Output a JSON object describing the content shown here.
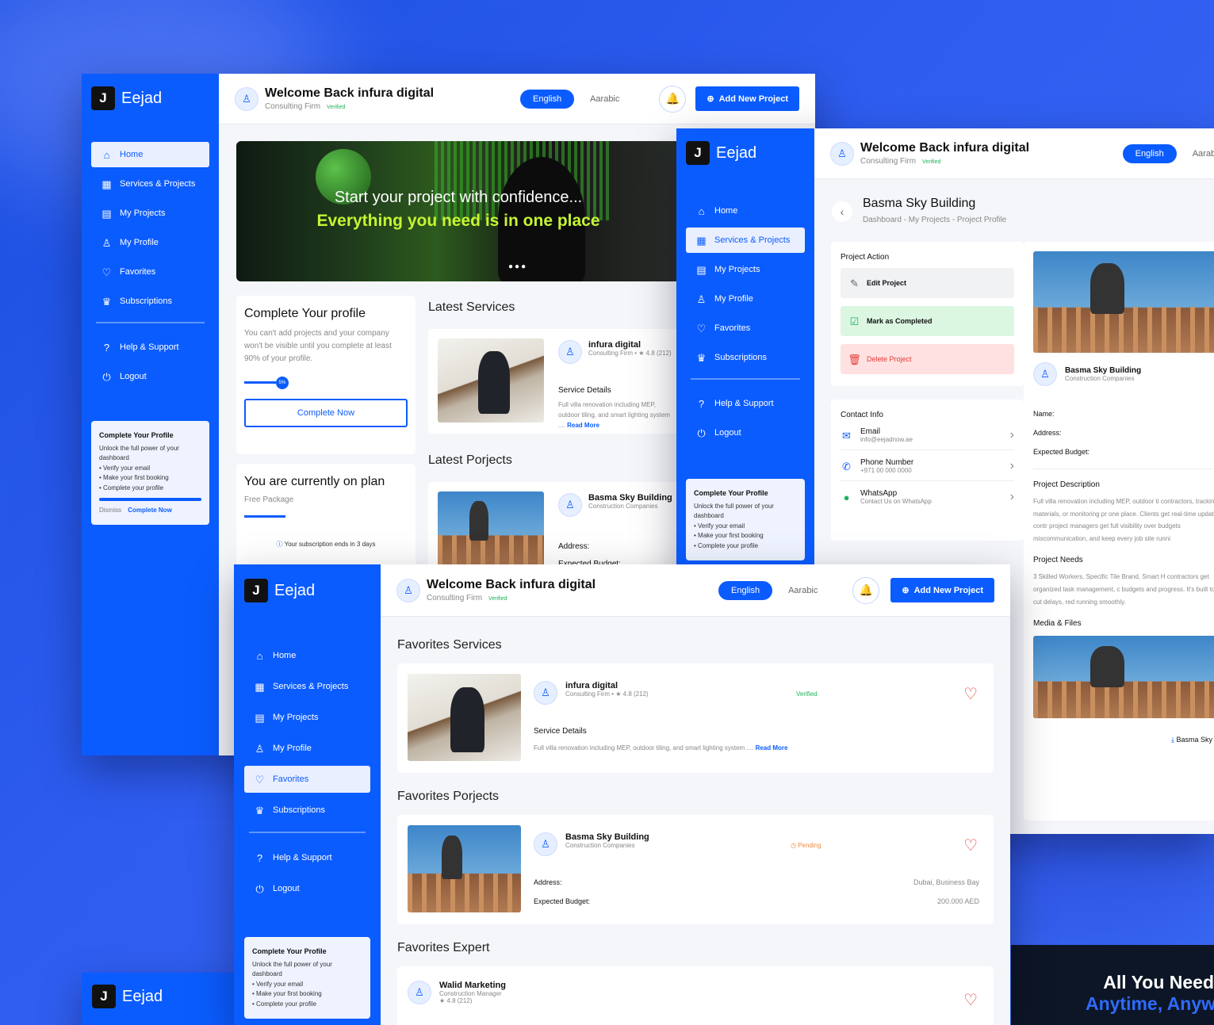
{
  "brand": {
    "name": "Eejad",
    "logo_letter": "J"
  },
  "nav": {
    "home": "Home",
    "services": "Services & Projects",
    "my_projects": "My Projects",
    "my_profile": "My Profile",
    "favorites": "Favorites",
    "subscriptions": "Subscriptions",
    "help": "Help & Support",
    "logout": "Logout"
  },
  "promo": {
    "title": "Complete Your Profile",
    "body": "Unlock the full power of your dashboard",
    "item1": "• Verify your email",
    "item2": "• Make your first booking",
    "item3": "• Complete your profile",
    "dismiss": "Dismiss",
    "cta": "Complete Now"
  },
  "header": {
    "welcome": "Welcome Back infura digital",
    "subtitle": "Consulting Firm",
    "verified": "Verified",
    "lang_en": "English",
    "lang_ar": "Aarabic",
    "add_project": "Add New Project"
  },
  "home": {
    "hero_line1": "Start your project with confidence...",
    "hero_line2": "Everything you need is in one place",
    "profile_title": "Complete Your profile",
    "profile_text": "You can't add projects and your company won't be visible until you complete at least 90% of your profile.",
    "profile_progress": "5%",
    "complete_now": "Complete Now",
    "plan_title": "You are currently on plan",
    "plan_name": "Free Package",
    "plan_notice": "Your subscription ends in 3 days",
    "latest_services": "Latest Services",
    "latest_projects": "Latest Porjects",
    "svc_company": "infura digital",
    "svc_meta": "Consulting Firm • ★ 4.8 (212)",
    "svc_details": "Service Details",
    "svc_text": "Full villa renovation including MEP, outdoor tiling, and smart lighting system ....",
    "read_more": "Read More",
    "proj_name": "Basma Sky Building",
    "proj_meta": "Construction Companies",
    "address_label": "Address:",
    "budget_label": "Expected Budget:"
  },
  "profile": {
    "title": "Basma Sky Building",
    "breadcrumb": "Dashboard - My Projects - Project Profile",
    "action_title": "Project Action",
    "edit": "Edit Project",
    "complete": "Mark as Completed",
    "delete": "Delete Project",
    "contact_title": "Contact Info",
    "email_label": "Email",
    "email_value": "info@eejadnow.ae",
    "phone_label": "Phone Number",
    "phone_value": "+971 00 000 0000",
    "wa_label": "WhatsApp",
    "wa_value": "Contact Us on WhatsApp",
    "company": "Basma Sky Building",
    "company_meta": "Construction Companies",
    "name_label": "Name:",
    "address_label": "Address:",
    "budget_label": "Expected Budget:",
    "desc_title": "Project Description",
    "desc_text": "Full villa renovation including MEP, outdoor ti contractors, tracking materials, or monitoring pr one place. Clients get real-time updates, contr project managers get full visibility over budgets miscommunication, and keep every job site runni",
    "needs_title": "Project Needs",
    "needs_text": "3 Skilled Workers, Specific Tile Brand, Smart H contractors get organized task management, c budgets and progress. It's built to cut delays, red running smoothly.",
    "media_title": "Media & Files",
    "file_name": "Basma Sky"
  },
  "favorites": {
    "services_title": "Favorites Services",
    "projects_title": "Favorites Porjects",
    "expert_title": "Favorites Expert",
    "svc_company": "infura digital",
    "svc_meta": "Consulting Firm • ★ 4.8 (212)",
    "svc_verified": "Verified",
    "svc_details": "Service Details",
    "svc_text": "Full villa renovation including MEP, outdoor tiling, and smart lighting system ....",
    "read_more": "Read More",
    "proj_name": "Basma Sky Building",
    "proj_meta": "Construction Companies",
    "proj_status": "Pending",
    "address_label": "Address:",
    "address_value": "Dubai, Business Bay",
    "budget_label": "Expected Budget:",
    "budget_value": "200.000 AED",
    "expert_name": "Walid Marketing",
    "expert_role": "Construction Manager",
    "expert_rating": "★ 4.8 (212)"
  },
  "banner": {
    "line1": "All You Need",
    "line2": "Anytime, Anyw"
  },
  "colors": {
    "primary": "#0b5cff",
    "accent_green": "#c6f432",
    "danger": "#e53935",
    "success": "#20b25a"
  }
}
